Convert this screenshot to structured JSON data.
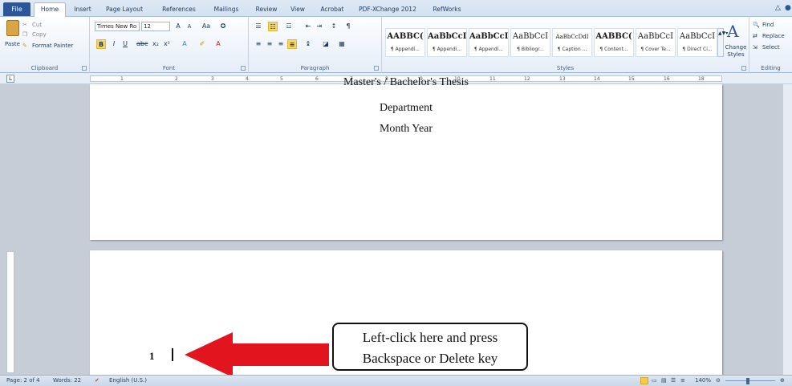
{
  "tabs": {
    "file": "File",
    "items": [
      "Home",
      "Insert",
      "Page Layout",
      "References",
      "Mailings",
      "Review",
      "View",
      "Acrobat",
      "PDF-XChange 2012",
      "RefWorks"
    ]
  },
  "clipboard": {
    "paste": "Paste",
    "cut": "Cut",
    "copy": "Copy",
    "format_painter": "Format Painter",
    "label": "Clipboard"
  },
  "font": {
    "name": "Times New Ro",
    "size": "12",
    "label": "Font"
  },
  "paragraph": {
    "label": "Paragraph"
  },
  "styles": {
    "items": [
      {
        "sample": "AABBC(",
        "name": "¶ Appendi..."
      },
      {
        "sample": "AaBbCcI",
        "name": "¶ Appendi..."
      },
      {
        "sample": "AaBbCcI",
        "name": "¶ Appendi..."
      },
      {
        "sample": "AaBbCcI",
        "name": "¶ Bibliogr..."
      },
      {
        "sample": "AaBbCcDdI",
        "name": "¶ Caption ..."
      },
      {
        "sample": "AABBC(",
        "name": "¶ Content..."
      },
      {
        "sample": "AaBbCcI",
        "name": "¶ Cover Te..."
      },
      {
        "sample": "AaBbCcI",
        "name": "¶ Direct Ci..."
      }
    ],
    "change_styles": "Change Styles",
    "label": "Styles"
  },
  "editing": {
    "find": "Find",
    "replace": "Replace",
    "select": "Select",
    "label": "Editing"
  },
  "ruler": {
    "corner": "L",
    "ticks": [
      "1",
      "2",
      "3",
      "4",
      "5",
      "6",
      "7",
      "8",
      "9",
      "10",
      "11",
      "12",
      "13",
      "14",
      "15",
      "16",
      "18"
    ]
  },
  "page1": {
    "line1": "Master's / Bachelor's Thesis",
    "department": "Department",
    "month_year": "Month Year"
  },
  "page2": {
    "page_number": "1"
  },
  "callout": {
    "line1": "Left-click here and press",
    "line2": "Backspace or Delete key"
  },
  "status": {
    "page": "Page: 2 of 4",
    "words": "Words: 22",
    "language": "English (U.S.)",
    "zoom": "140%"
  },
  "colors": {
    "arrow": "#e2141d",
    "file_tab": "#2b579a"
  }
}
